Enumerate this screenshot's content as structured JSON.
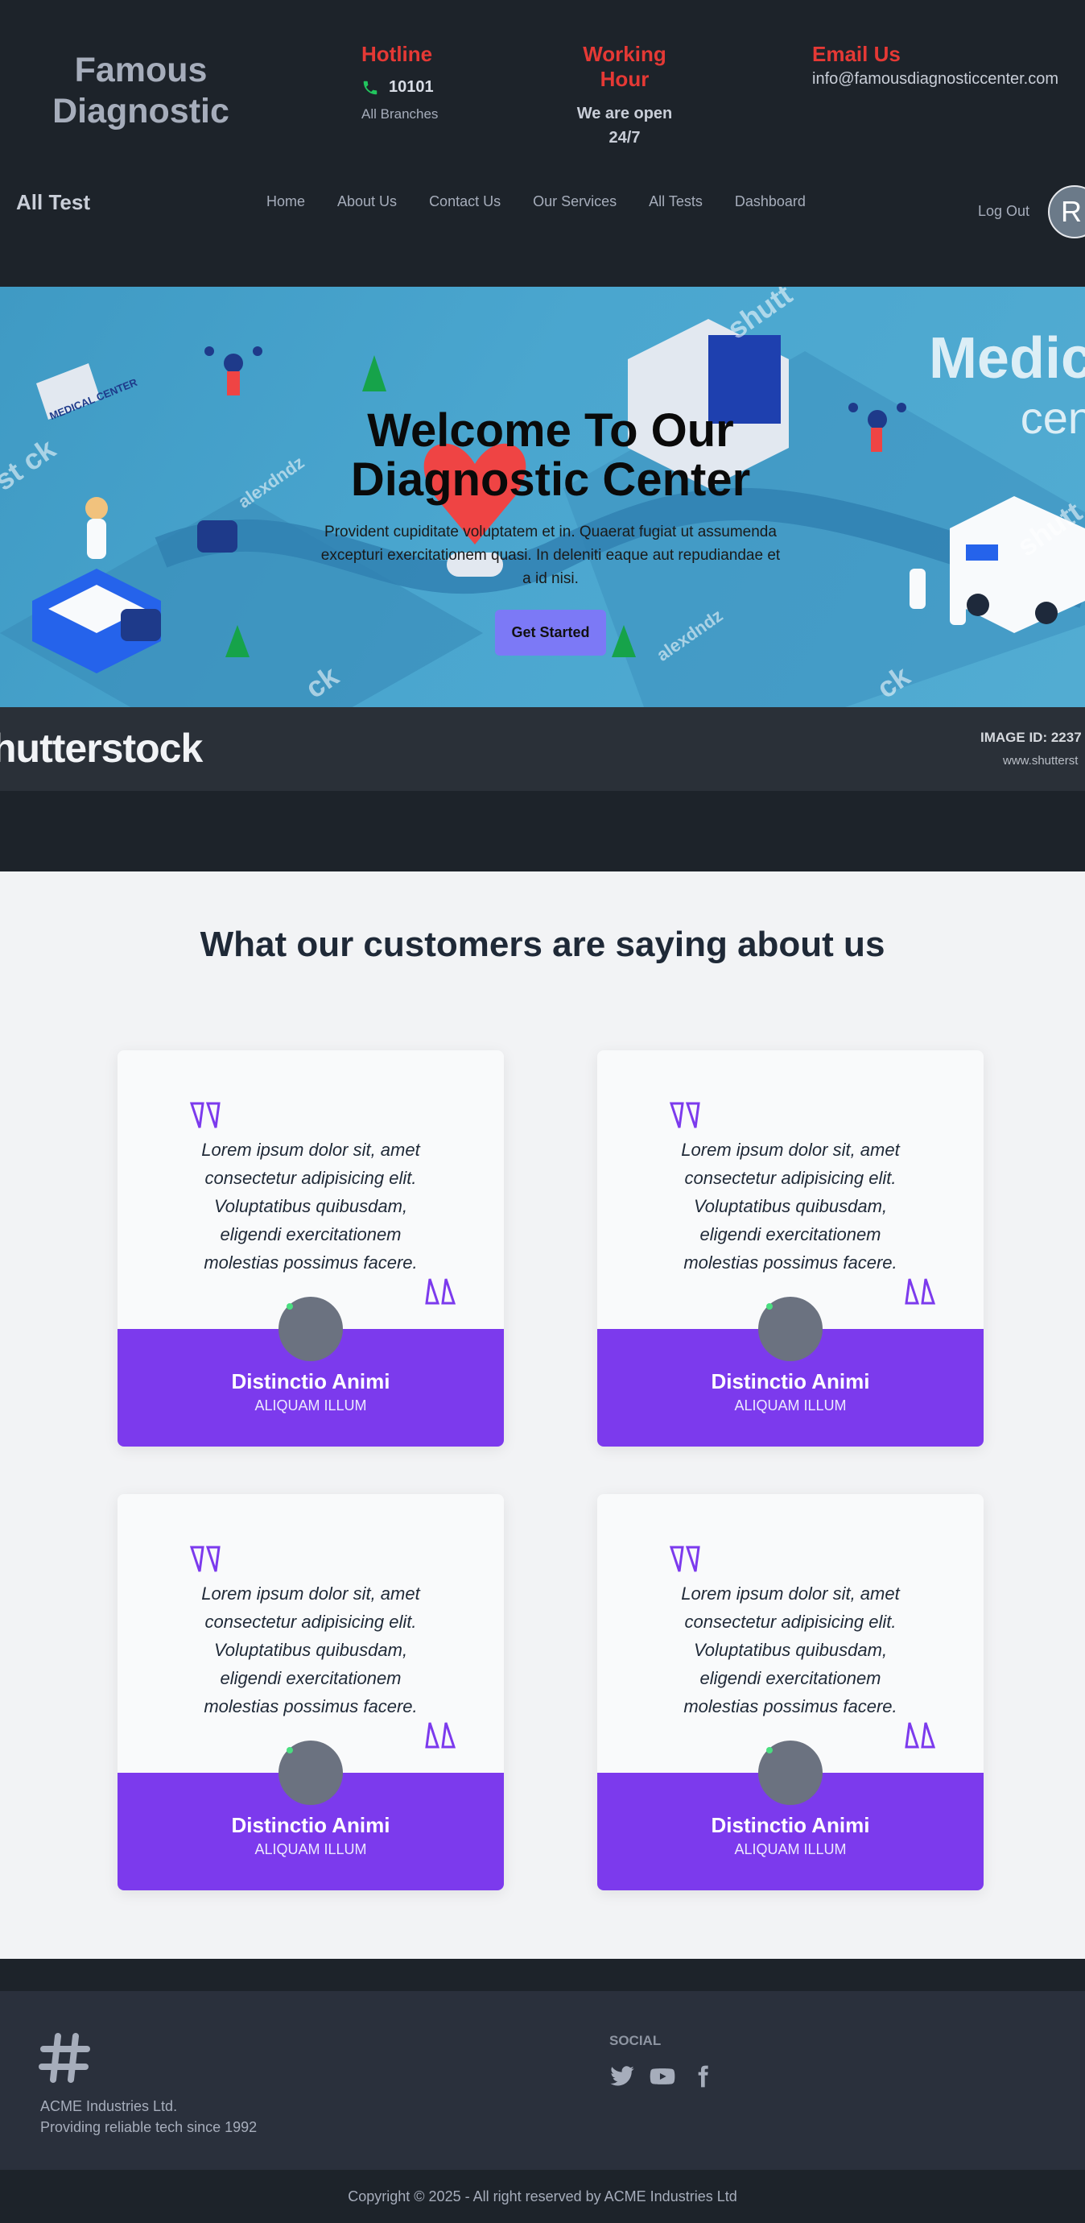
{
  "header": {
    "brand": "Famous Diagnostic",
    "hotline": {
      "title": "Hotline",
      "number": "10101",
      "sub": "All Branches"
    },
    "working": {
      "title": "Working Hour",
      "text": "We are open 24/7"
    },
    "email": {
      "title": "Email Us",
      "address": "info@famousdiagnosticcenter.com"
    }
  },
  "nav": {
    "title": "All Test",
    "items": [
      "Home",
      "About Us",
      "Contact Us",
      "Our Services",
      "All Tests",
      "Dashboard"
    ],
    "logout": "Log Out",
    "avatar_initial": "R"
  },
  "hero": {
    "title": "Welcome To Our Diagnostic Center",
    "description": "Provident cupiditate voluptatem et in. Quaerat fugiat ut assumenda excepturi exercitationem quasi. In deleniti eaque aut repudiandae et a id nisi.",
    "button": "Get Started",
    "illustration_text": {
      "medical": "Medic",
      "center": "cen",
      "medical_center_sign": "MEDICAL CENTER",
      "watermark_1": "shutt",
      "watermark_2": "st ck",
      "watermark_3": "alexdndz",
      "watermark_4": "alexdndz",
      "watermark_5": "ck",
      "watermark_6": "ck",
      "watermark_7": "shutt"
    },
    "shutter_logo": "hutterstock",
    "image_id": "IMAGE ID: 2237",
    "image_url": "www.shutterst"
  },
  "testimonials": {
    "heading": "What our customers are saying about us",
    "cards": [
      {
        "text": "Lorem ipsum dolor sit, amet consectetur adipisicing elit. Voluptatibus quibusdam, eligendi exercitationem molestias possimus facere.",
        "name": "Distinctio Animi",
        "role": "ALIQUAM ILLUM"
      },
      {
        "text": "Lorem ipsum dolor sit, amet consectetur adipisicing elit. Voluptatibus quibusdam, eligendi exercitationem molestias possimus facere.",
        "name": "Distinctio Animi",
        "role": "ALIQUAM ILLUM"
      },
      {
        "text": "Lorem ipsum dolor sit, amet consectetur adipisicing elit. Voluptatibus quibusdam, eligendi exercitationem molestias possimus facere.",
        "name": "Distinctio Animi",
        "role": "ALIQUAM ILLUM"
      },
      {
        "text": "Lorem ipsum dolor sit, amet consectetur adipisicing elit. Voluptatibus quibusdam, eligendi exercitationem molestias possimus facere.",
        "name": "Distinctio Animi",
        "role": "ALIQUAM ILLUM"
      }
    ]
  },
  "footer": {
    "company_line1": "ACME Industries Ltd.",
    "company_line2": "Providing reliable tech since 1992",
    "social_title": "Social",
    "social_icons": [
      "twitter-icon",
      "youtube-icon",
      "facebook-icon"
    ],
    "copyright": "Copyright © 2025 - All right reserved by ACME Industries Ltd"
  },
  "colors": {
    "dark_bg": "#1d232a",
    "accent_red": "#e53935",
    "accent_purple": "#7c3aed",
    "button_purple": "#7c79f6",
    "hero_blue": "#4aa6cf"
  }
}
